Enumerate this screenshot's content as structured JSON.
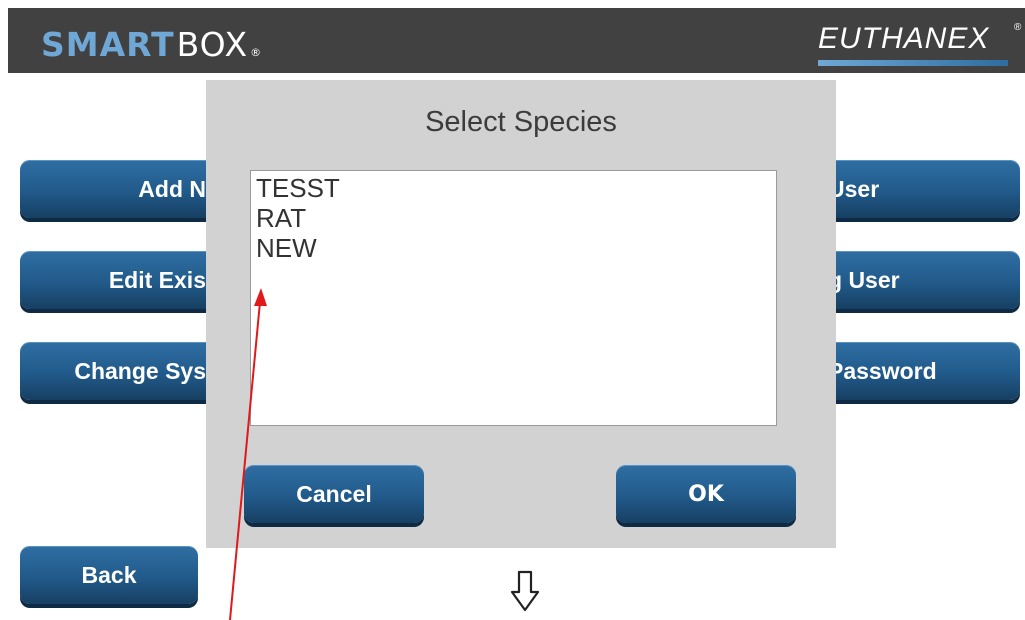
{
  "header": {
    "logo_smart": "SMART",
    "logo_box": "BOX",
    "logo_reg": "®",
    "brand_right": "EUTHANEX",
    "brand_right_reg": "®"
  },
  "left_buttons": [
    {
      "label": "Add N"
    },
    {
      "label": "Edit Exis"
    },
    {
      "label": "Change Sys"
    }
  ],
  "right_buttons": [
    {
      "label": "User"
    },
    {
      "label": "g User"
    },
    {
      "label": "Password"
    }
  ],
  "back_button": {
    "label": "Back"
  },
  "dialog": {
    "title": "Select Species",
    "items": [
      "TESST",
      "RAT",
      "NEW"
    ],
    "cancel_label": "Cancel",
    "ok_label": "OK"
  },
  "icons": {
    "scroll_down": "down-arrow-icon",
    "annotation": "red-arrow-annotation"
  },
  "colors": {
    "header_bg": "#414141",
    "button_blue": "#215a8a",
    "dialog_bg": "#d2d2d2",
    "annotation_red": "#e0191b",
    "logo_accent": "#6fa8d6"
  }
}
